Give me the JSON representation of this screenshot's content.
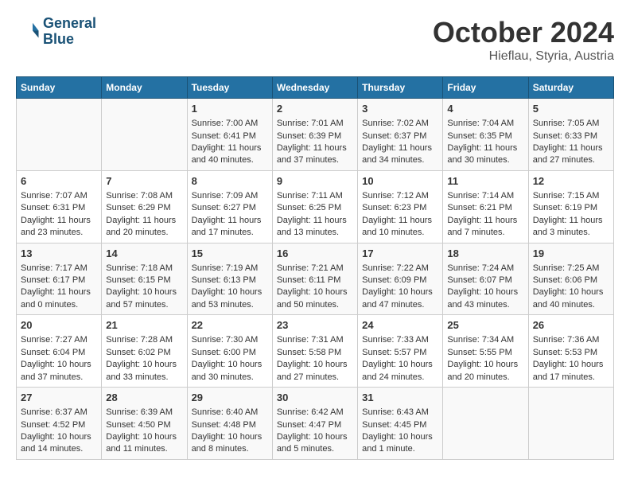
{
  "header": {
    "logo_line1": "General",
    "logo_line2": "Blue",
    "month": "October 2024",
    "location": "Hieflau, Styria, Austria"
  },
  "weekdays": [
    "Sunday",
    "Monday",
    "Tuesday",
    "Wednesday",
    "Thursday",
    "Friday",
    "Saturday"
  ],
  "weeks": [
    [
      {
        "day": "",
        "sunrise": "",
        "sunset": "",
        "daylight": ""
      },
      {
        "day": "",
        "sunrise": "",
        "sunset": "",
        "daylight": ""
      },
      {
        "day": "1",
        "sunrise": "Sunrise: 7:00 AM",
        "sunset": "Sunset: 6:41 PM",
        "daylight": "Daylight: 11 hours and 40 minutes."
      },
      {
        "day": "2",
        "sunrise": "Sunrise: 7:01 AM",
        "sunset": "Sunset: 6:39 PM",
        "daylight": "Daylight: 11 hours and 37 minutes."
      },
      {
        "day": "3",
        "sunrise": "Sunrise: 7:02 AM",
        "sunset": "Sunset: 6:37 PM",
        "daylight": "Daylight: 11 hours and 34 minutes."
      },
      {
        "day": "4",
        "sunrise": "Sunrise: 7:04 AM",
        "sunset": "Sunset: 6:35 PM",
        "daylight": "Daylight: 11 hours and 30 minutes."
      },
      {
        "day": "5",
        "sunrise": "Sunrise: 7:05 AM",
        "sunset": "Sunset: 6:33 PM",
        "daylight": "Daylight: 11 hours and 27 minutes."
      }
    ],
    [
      {
        "day": "6",
        "sunrise": "Sunrise: 7:07 AM",
        "sunset": "Sunset: 6:31 PM",
        "daylight": "Daylight: 11 hours and 23 minutes."
      },
      {
        "day": "7",
        "sunrise": "Sunrise: 7:08 AM",
        "sunset": "Sunset: 6:29 PM",
        "daylight": "Daylight: 11 hours and 20 minutes."
      },
      {
        "day": "8",
        "sunrise": "Sunrise: 7:09 AM",
        "sunset": "Sunset: 6:27 PM",
        "daylight": "Daylight: 11 hours and 17 minutes."
      },
      {
        "day": "9",
        "sunrise": "Sunrise: 7:11 AM",
        "sunset": "Sunset: 6:25 PM",
        "daylight": "Daylight: 11 hours and 13 minutes."
      },
      {
        "day": "10",
        "sunrise": "Sunrise: 7:12 AM",
        "sunset": "Sunset: 6:23 PM",
        "daylight": "Daylight: 11 hours and 10 minutes."
      },
      {
        "day": "11",
        "sunrise": "Sunrise: 7:14 AM",
        "sunset": "Sunset: 6:21 PM",
        "daylight": "Daylight: 11 hours and 7 minutes."
      },
      {
        "day": "12",
        "sunrise": "Sunrise: 7:15 AM",
        "sunset": "Sunset: 6:19 PM",
        "daylight": "Daylight: 11 hours and 3 minutes."
      }
    ],
    [
      {
        "day": "13",
        "sunrise": "Sunrise: 7:17 AM",
        "sunset": "Sunset: 6:17 PM",
        "daylight": "Daylight: 11 hours and 0 minutes."
      },
      {
        "day": "14",
        "sunrise": "Sunrise: 7:18 AM",
        "sunset": "Sunset: 6:15 PM",
        "daylight": "Daylight: 10 hours and 57 minutes."
      },
      {
        "day": "15",
        "sunrise": "Sunrise: 7:19 AM",
        "sunset": "Sunset: 6:13 PM",
        "daylight": "Daylight: 10 hours and 53 minutes."
      },
      {
        "day": "16",
        "sunrise": "Sunrise: 7:21 AM",
        "sunset": "Sunset: 6:11 PM",
        "daylight": "Daylight: 10 hours and 50 minutes."
      },
      {
        "day": "17",
        "sunrise": "Sunrise: 7:22 AM",
        "sunset": "Sunset: 6:09 PM",
        "daylight": "Daylight: 10 hours and 47 minutes."
      },
      {
        "day": "18",
        "sunrise": "Sunrise: 7:24 AM",
        "sunset": "Sunset: 6:07 PM",
        "daylight": "Daylight: 10 hours and 43 minutes."
      },
      {
        "day": "19",
        "sunrise": "Sunrise: 7:25 AM",
        "sunset": "Sunset: 6:06 PM",
        "daylight": "Daylight: 10 hours and 40 minutes."
      }
    ],
    [
      {
        "day": "20",
        "sunrise": "Sunrise: 7:27 AM",
        "sunset": "Sunset: 6:04 PM",
        "daylight": "Daylight: 10 hours and 37 minutes."
      },
      {
        "day": "21",
        "sunrise": "Sunrise: 7:28 AM",
        "sunset": "Sunset: 6:02 PM",
        "daylight": "Daylight: 10 hours and 33 minutes."
      },
      {
        "day": "22",
        "sunrise": "Sunrise: 7:30 AM",
        "sunset": "Sunset: 6:00 PM",
        "daylight": "Daylight: 10 hours and 30 minutes."
      },
      {
        "day": "23",
        "sunrise": "Sunrise: 7:31 AM",
        "sunset": "Sunset: 5:58 PM",
        "daylight": "Daylight: 10 hours and 27 minutes."
      },
      {
        "day": "24",
        "sunrise": "Sunrise: 7:33 AM",
        "sunset": "Sunset: 5:57 PM",
        "daylight": "Daylight: 10 hours and 24 minutes."
      },
      {
        "day": "25",
        "sunrise": "Sunrise: 7:34 AM",
        "sunset": "Sunset: 5:55 PM",
        "daylight": "Daylight: 10 hours and 20 minutes."
      },
      {
        "day": "26",
        "sunrise": "Sunrise: 7:36 AM",
        "sunset": "Sunset: 5:53 PM",
        "daylight": "Daylight: 10 hours and 17 minutes."
      }
    ],
    [
      {
        "day": "27",
        "sunrise": "Sunrise: 6:37 AM",
        "sunset": "Sunset: 4:52 PM",
        "daylight": "Daylight: 10 hours and 14 minutes."
      },
      {
        "day": "28",
        "sunrise": "Sunrise: 6:39 AM",
        "sunset": "Sunset: 4:50 PM",
        "daylight": "Daylight: 10 hours and 11 minutes."
      },
      {
        "day": "29",
        "sunrise": "Sunrise: 6:40 AM",
        "sunset": "Sunset: 4:48 PM",
        "daylight": "Daylight: 10 hours and 8 minutes."
      },
      {
        "day": "30",
        "sunrise": "Sunrise: 6:42 AM",
        "sunset": "Sunset: 4:47 PM",
        "daylight": "Daylight: 10 hours and 5 minutes."
      },
      {
        "day": "31",
        "sunrise": "Sunrise: 6:43 AM",
        "sunset": "Sunset: 4:45 PM",
        "daylight": "Daylight: 10 hours and 1 minute."
      },
      {
        "day": "",
        "sunrise": "",
        "sunset": "",
        "daylight": ""
      },
      {
        "day": "",
        "sunrise": "",
        "sunset": "",
        "daylight": ""
      }
    ]
  ]
}
